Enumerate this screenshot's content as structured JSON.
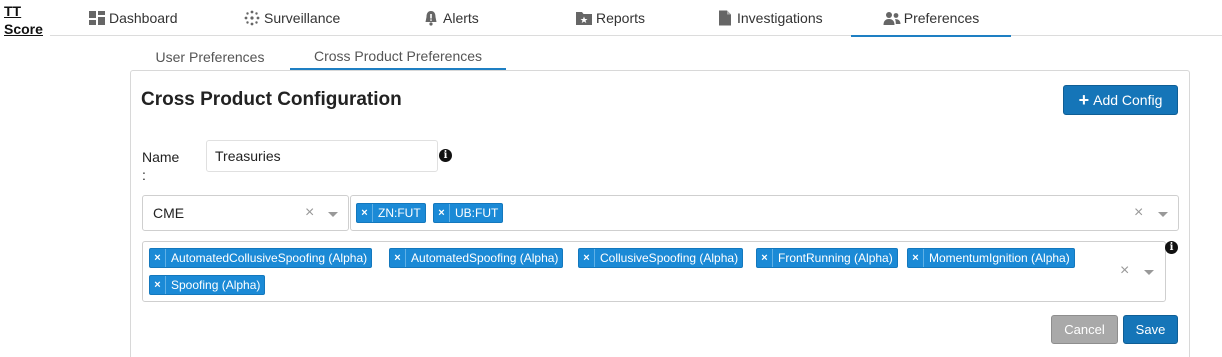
{
  "brand": {
    "line1": "TT",
    "line2": "Score"
  },
  "nav": {
    "items": [
      {
        "label": "Dashboard",
        "icon": "dashboard-icon"
      },
      {
        "label": "Surveillance",
        "icon": "surveillance-icon"
      },
      {
        "label": "Alerts",
        "icon": "bell-icon"
      },
      {
        "label": "Reports",
        "icon": "folder-star-icon"
      },
      {
        "label": "Investigations",
        "icon": "document-icon"
      },
      {
        "label": "Preferences",
        "icon": "users-icon",
        "active": true
      }
    ]
  },
  "subtabs": [
    {
      "label": "User Preferences"
    },
    {
      "label": "Cross Product Preferences",
      "active": true
    }
  ],
  "panel": {
    "title": "Cross Product Configuration",
    "add_button": "Add Config",
    "add_icon": "+",
    "name_label": "Name",
    "name_colon": ":",
    "name_value": "Treasuries",
    "info_glyph": "i",
    "exchange_value": "CME",
    "clear_glyph": "×",
    "products": [
      "ZN:FUT",
      "UB:FUT"
    ],
    "algorithms": [
      "AutomatedCollusiveSpoofing (Alpha)",
      "AutomatedSpoofing (Alpha)",
      "CollusiveSpoofing (Alpha)",
      "FrontRunning (Alpha)",
      "MomentumIgnition (Alpha)",
      "Spoofing (Alpha)"
    ],
    "tag_remove_glyph": "×",
    "cancel_button": "Cancel",
    "save_button": "Save"
  },
  "colors": {
    "accent": "#1575b8",
    "tag": "#1b8ad6",
    "cancel": "#a9a9a9"
  }
}
